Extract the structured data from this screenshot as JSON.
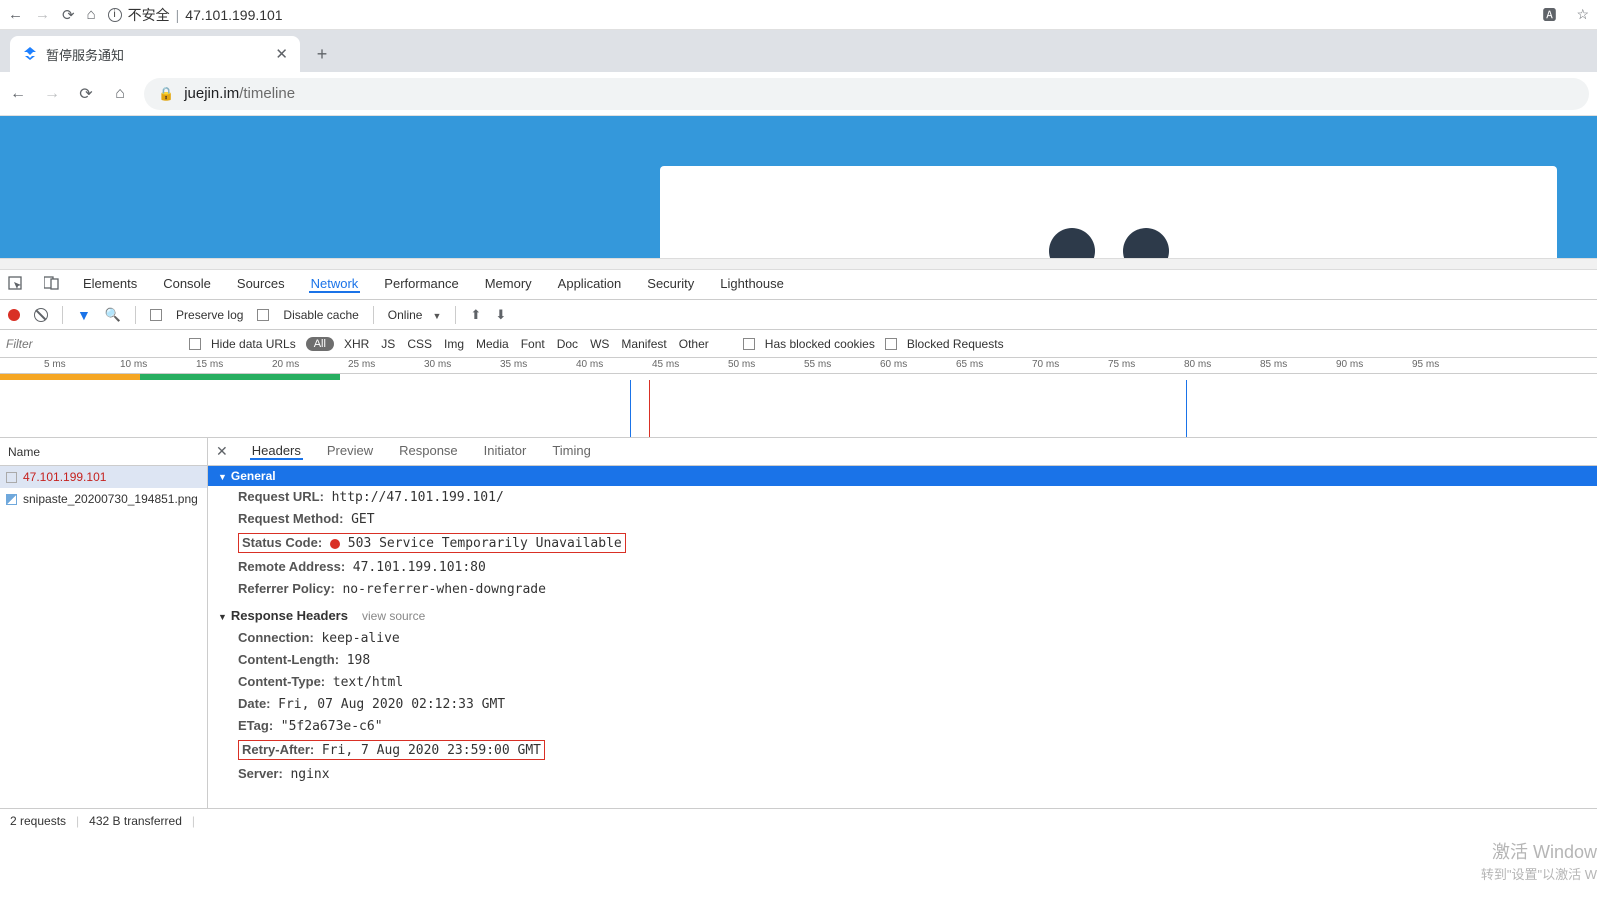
{
  "outerNav": {
    "insecure": "不安全",
    "address": "47.101.199.101"
  },
  "tab": {
    "title": "暂停服务通知"
  },
  "innerNav": {
    "urlHost": "juejin.im",
    "urlPath": "/timeline"
  },
  "devtoolsTabs": [
    "Elements",
    "Console",
    "Sources",
    "Network",
    "Performance",
    "Memory",
    "Application",
    "Security",
    "Lighthouse"
  ],
  "devtoolsActive": "Network",
  "toolbar": {
    "preserveLog": "Preserve log",
    "disableCache": "Disable cache",
    "online": "Online"
  },
  "filterRow": {
    "placeholder": "Filter",
    "hideData": "Hide data URLs",
    "all": "All",
    "chips": [
      "XHR",
      "JS",
      "CSS",
      "Img",
      "Media",
      "Font",
      "Doc",
      "WS",
      "Manifest",
      "Other"
    ],
    "blockedCookies": "Has blocked cookies",
    "blockedReq": "Blocked Requests"
  },
  "ruler": [
    "5 ms",
    "10 ms",
    "15 ms",
    "20 ms",
    "25 ms",
    "30 ms",
    "35 ms",
    "40 ms",
    "45 ms",
    "50 ms",
    "55 ms",
    "60 ms",
    "65 ms",
    "70 ms",
    "75 ms",
    "80 ms",
    "85 ms",
    "90 ms",
    "95 ms"
  ],
  "reqListHeader": "Name",
  "requests": [
    {
      "name": "47.101.199.101",
      "error": true,
      "selected": true,
      "type": "doc"
    },
    {
      "name": "snipaste_20200730_194851.png",
      "error": false,
      "selected": false,
      "type": "img"
    }
  ],
  "detailTabs": [
    "Headers",
    "Preview",
    "Response",
    "Initiator",
    "Timing"
  ],
  "detailActive": "Headers",
  "sections": {
    "general": {
      "title": "General",
      "items": [
        {
          "k": "Request URL:",
          "v": "http://47.101.199.101/"
        },
        {
          "k": "Request Method:",
          "v": "GET"
        },
        {
          "k": "Status Code:",
          "v": "503 Service Temporarily Unavailable",
          "status": true,
          "boxed": true
        },
        {
          "k": "Remote Address:",
          "v": "47.101.199.101:80"
        },
        {
          "k": "Referrer Policy:",
          "v": "no-referrer-when-downgrade"
        }
      ]
    },
    "response": {
      "title": "Response Headers",
      "viewSource": "view source",
      "items": [
        {
          "k": "Connection:",
          "v": "keep-alive"
        },
        {
          "k": "Content-Length:",
          "v": "198"
        },
        {
          "k": "Content-Type:",
          "v": "text/html"
        },
        {
          "k": "Date:",
          "v": "Fri, 07 Aug 2020 02:12:33 GMT"
        },
        {
          "k": "ETag:",
          "v": "\"5f2a673e-c6\""
        },
        {
          "k": "Retry-After:",
          "v": "Fri, 7 Aug 2020 23:59:00 GMT",
          "boxed": true
        },
        {
          "k": "Server:",
          "v": "nginx"
        }
      ]
    }
  },
  "statusbar": {
    "requests": "2 requests",
    "transferred": "432 B transferred"
  },
  "watermark": {
    "big": "激活 Window",
    "small": "转到\"设置\"以激活 W"
  }
}
